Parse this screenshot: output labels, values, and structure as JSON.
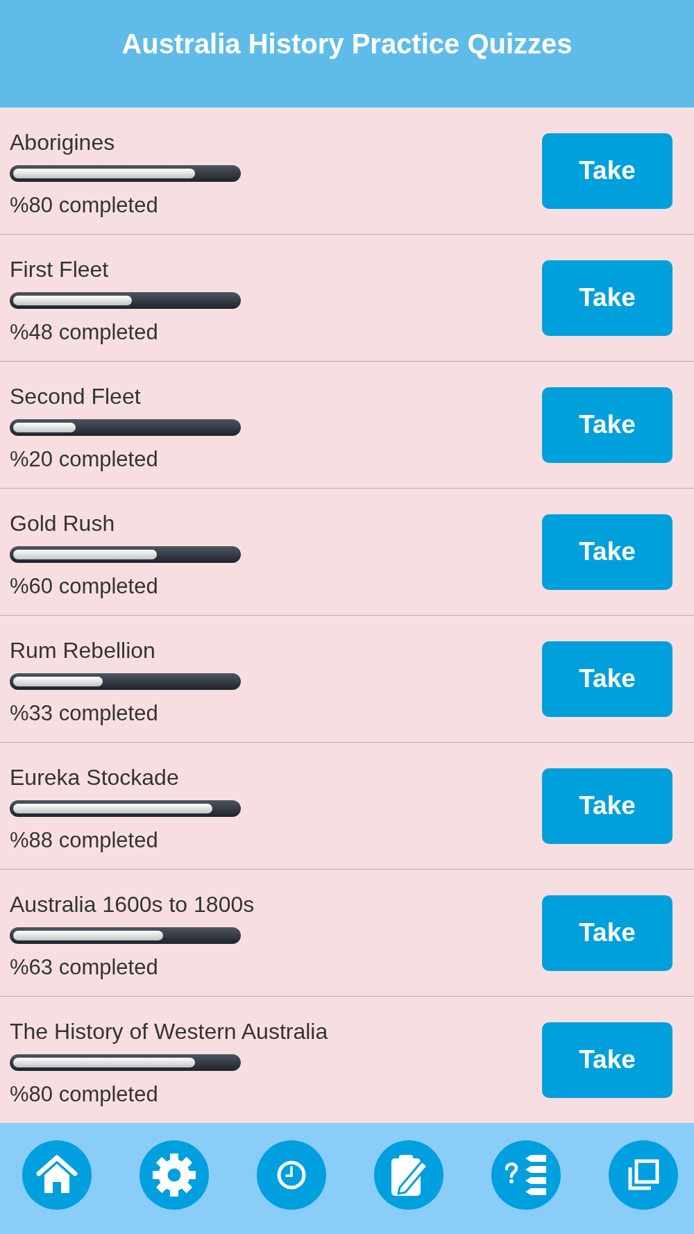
{
  "header": {
    "title": "Australia History Practice Quizzes"
  },
  "quizzes": [
    {
      "name": "Aborigines",
      "level": 0.81,
      "progress_text": "%80 completed",
      "button": "Take"
    },
    {
      "name": "First Fleet",
      "level": 0.53,
      "progress_text": "%48 completed",
      "button": "Take"
    },
    {
      "name": "Second Fleet",
      "level": 0.28,
      "progress_text": "%20 completed",
      "button": "Take"
    },
    {
      "name": "Gold Rush",
      "level": 0.64,
      "progress_text": "%60 completed",
      "button": "Take"
    },
    {
      "name": "Rum Rebellion",
      "level": 0.4,
      "progress_text": "%33 completed",
      "button": "Take"
    },
    {
      "name": "Eureka Stockade",
      "level": 0.89,
      "progress_text": "%88 completed",
      "button": "Take"
    },
    {
      "name": "Australia 1600s to 1800s",
      "level": 0.67,
      "progress_text": "%63 completed",
      "button": "Take"
    },
    {
      "name": "The History of Western Australia",
      "level": 0.81,
      "progress_text": "%80 completed",
      "button": "Take"
    }
  ]
}
